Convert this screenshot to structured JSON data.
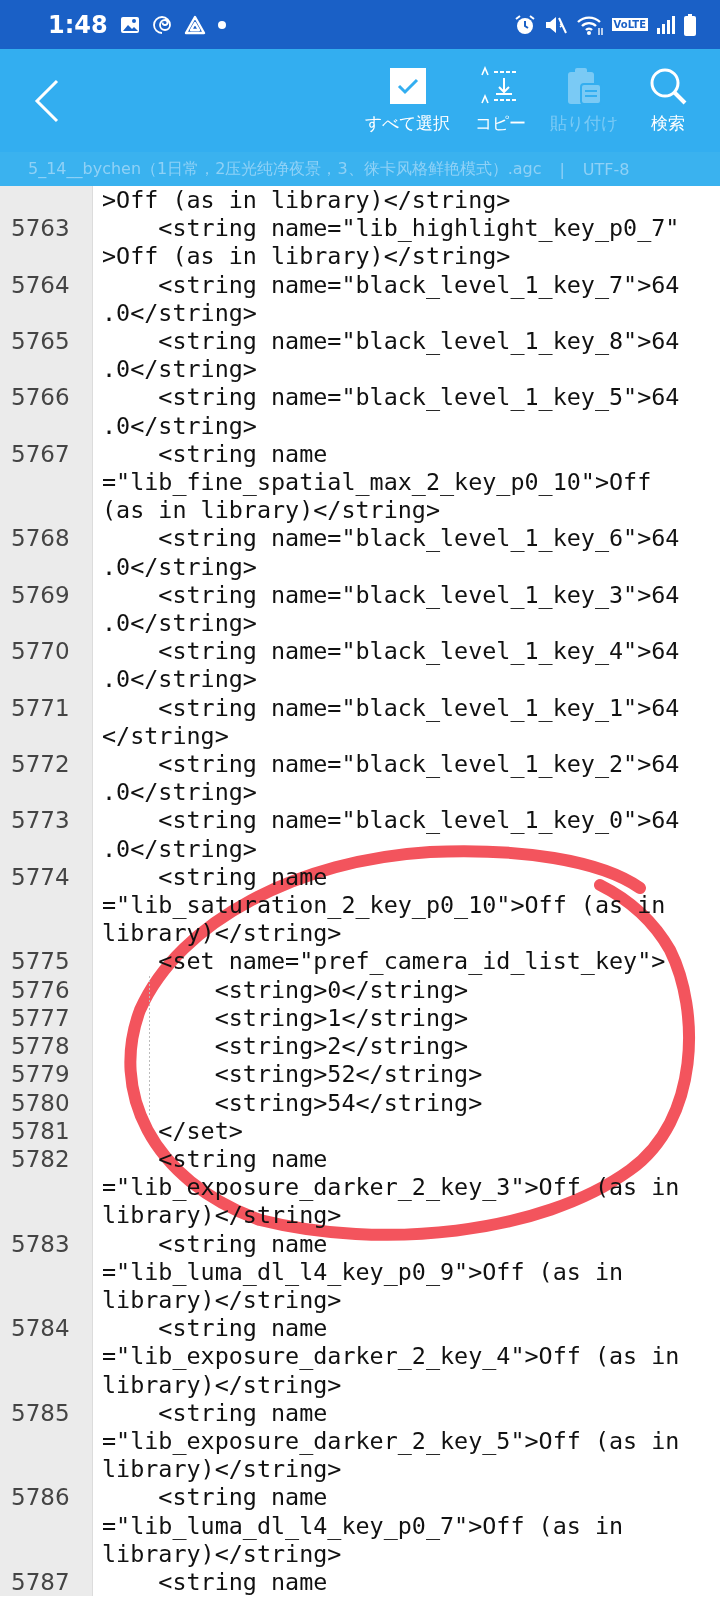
{
  "status_bar": {
    "time": "1:48",
    "network_label": "VoLTE"
  },
  "toolbar": {
    "actions": [
      {
        "kind": "select_all",
        "label": "すべて選択",
        "disabled": false
      },
      {
        "kind": "copy",
        "label": "コピー",
        "disabled": false
      },
      {
        "kind": "paste",
        "label": "貼り付け",
        "disabled": true
      },
      {
        "kind": "search",
        "label": "検索",
        "disabled": false
      }
    ]
  },
  "file_bar": {
    "filename": "5_14__bychen（1日常，2压光纯净夜景，3、徕卡风格鲜艳模式）.agc",
    "separator": "|",
    "encoding": "UTF-8"
  },
  "editor": {
    "lines": [
      {
        "rows": [
          ">Off (as in library)</string>"
        ]
      },
      {
        "number": "5763",
        "rows": [
          "    <string name=\"lib_highlight_key_p0_7\"",
          ">Off (as in library)</string>"
        ]
      },
      {
        "number": "5764",
        "rows": [
          "    <string name=\"black_level_1_key_7\">64",
          ".0</string>"
        ]
      },
      {
        "number": "5765",
        "rows": [
          "    <string name=\"black_level_1_key_8\">64",
          ".0</string>"
        ]
      },
      {
        "number": "5766",
        "rows": [
          "    <string name=\"black_level_1_key_5\">64",
          ".0</string>"
        ]
      },
      {
        "number": "5767",
        "rows": [
          "    <string name",
          "=\"lib_fine_spatial_max_2_key_p0_10\">Off",
          "(as in library)</string>"
        ]
      },
      {
        "number": "5768",
        "rows": [
          "    <string name=\"black_level_1_key_6\">64",
          ".0</string>"
        ]
      },
      {
        "number": "5769",
        "rows": [
          "    <string name=\"black_level_1_key_3\">64",
          ".0</string>"
        ]
      },
      {
        "number": "5770",
        "rows": [
          "    <string name=\"black_level_1_key_4\">64",
          ".0</string>"
        ]
      },
      {
        "number": "5771",
        "rows": [
          "    <string name=\"black_level_1_key_1\">64",
          "</string>"
        ]
      },
      {
        "number": "5772",
        "rows": [
          "    <string name=\"black_level_1_key_2\">64",
          ".0</string>"
        ]
      },
      {
        "number": "5773",
        "rows": [
          "    <string name=\"black_level_1_key_0\">64",
          ".0</string>"
        ]
      },
      {
        "number": "5774",
        "rows": [
          "    <string name",
          "=\"lib_saturation_2_key_p0_10\">Off (as in",
          "library)</string>"
        ]
      },
      {
        "number": "5775",
        "rows": [
          "    <set name=\"pref_camera_id_list_key\">"
        ]
      },
      {
        "number": "5776",
        "guide": true,
        "rows": [
          "        <string>0</string>"
        ]
      },
      {
        "number": "5777",
        "guide": true,
        "rows": [
          "        <string>1</string>"
        ]
      },
      {
        "number": "5778",
        "guide": true,
        "rows": [
          "        <string>2</string>"
        ]
      },
      {
        "number": "5779",
        "guide": true,
        "rows": [
          "        <string>52</string>"
        ]
      },
      {
        "number": "5780",
        "guide": true,
        "rows": [
          "        <string>54</string>"
        ]
      },
      {
        "number": "5781",
        "rows": [
          "    </set>"
        ]
      },
      {
        "number": "5782",
        "rows": [
          "    <string name",
          "=\"lib_exposure_darker_2_key_3\">Off (as in",
          "library)</string>"
        ]
      },
      {
        "number": "5783",
        "rows": [
          "    <string name",
          "=\"lib_luma_dl_l4_key_p0_9\">Off (as in",
          "library)</string>"
        ]
      },
      {
        "number": "5784",
        "rows": [
          "    <string name",
          "=\"lib_exposure_darker_2_key_4\">Off (as in",
          "library)</string>"
        ]
      },
      {
        "number": "5785",
        "rows": [
          "    <string name",
          "=\"lib_exposure_darker_2_key_5\">Off (as in",
          "library)</string>"
        ]
      },
      {
        "number": "5786",
        "rows": [
          "    <string name",
          "=\"lib_luma_dl_l4_key_p0_7\">Off (as in",
          "library)</string>"
        ]
      },
      {
        "number": "5787",
        "rows": [
          "    <string name"
        ]
      }
    ]
  }
}
